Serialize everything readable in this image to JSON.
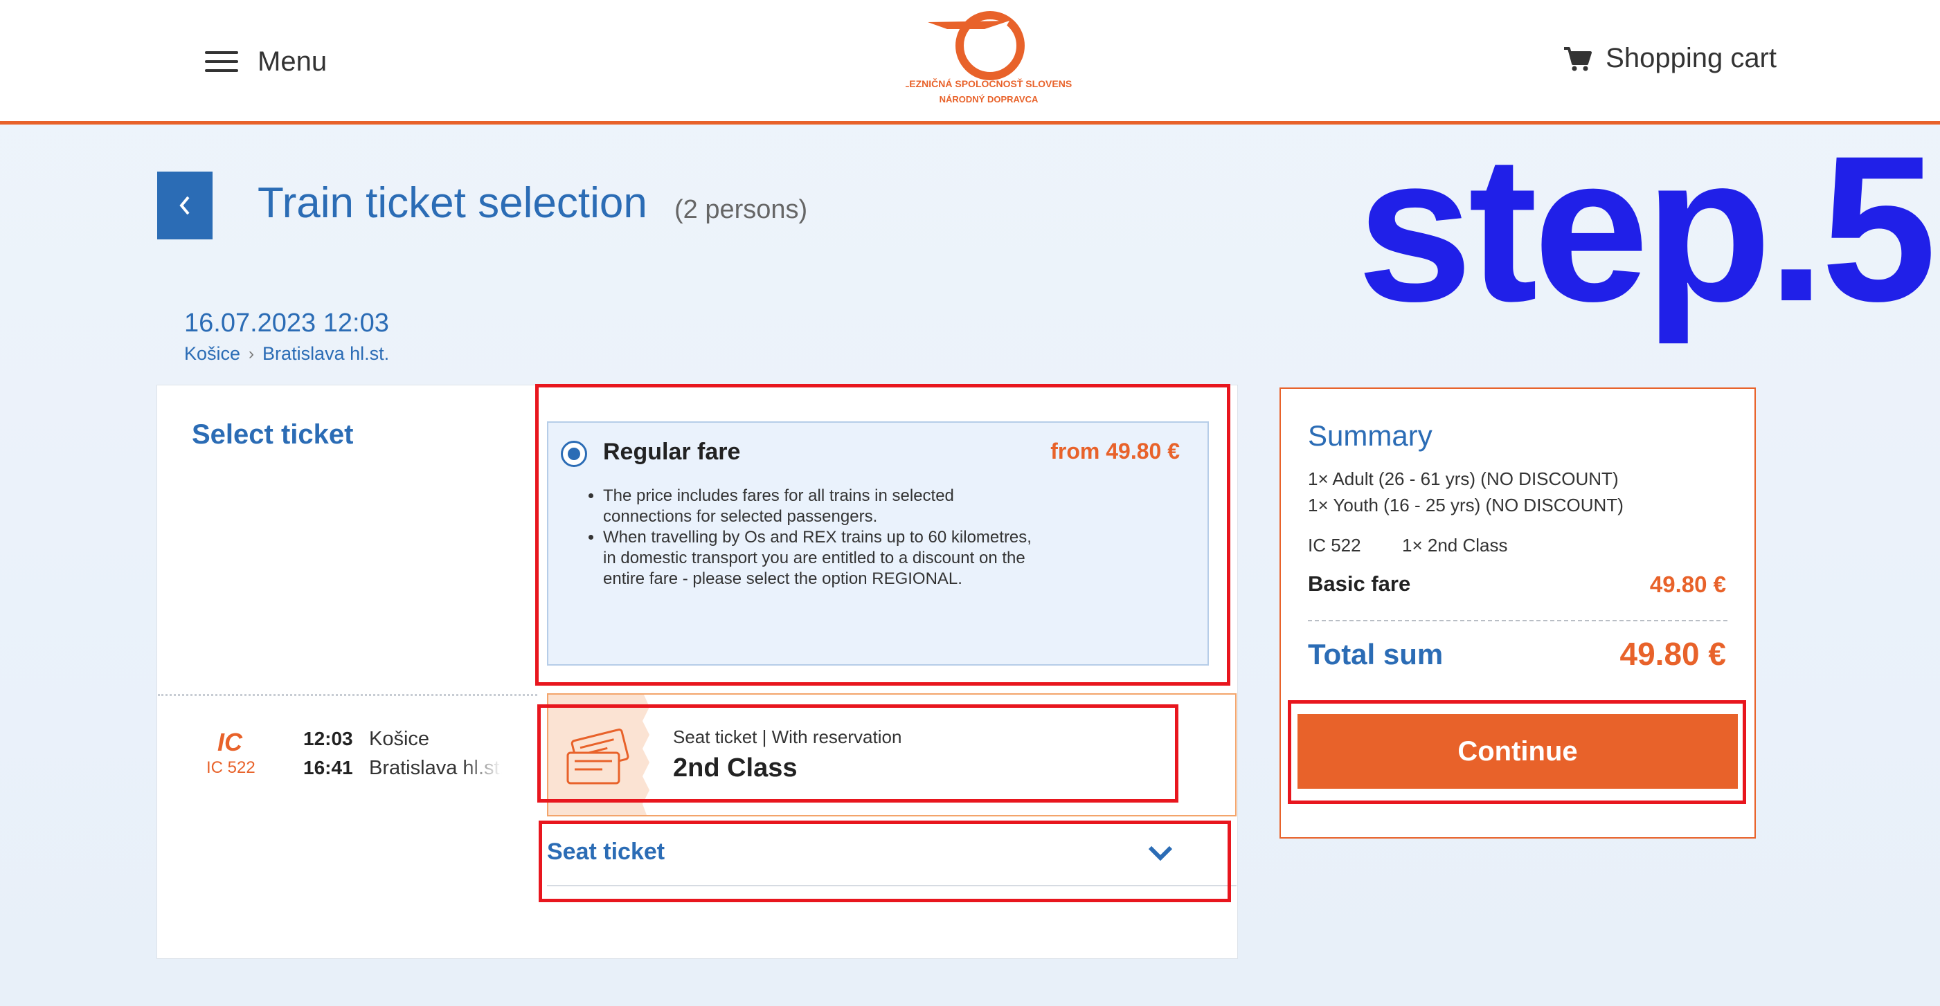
{
  "header": {
    "menu_label": "Menu",
    "cart_label": "Shopping cart",
    "logo_line1": "ŽELEZNIČNÁ SPOLOČNOSŤ SLOVENSKO",
    "logo_line2": "NÁRODNÝ DOPRAVCA",
    "accent_color": "#e8622a"
  },
  "page": {
    "title": "Train ticket selection",
    "persons": "(2 persons)",
    "step_label": "step.5"
  },
  "journey": {
    "datetime": "16.07.2023 12:03",
    "from": "Košice",
    "to": "Bratislava hl.st."
  },
  "select": {
    "title": "Select ticket",
    "fare": {
      "name": "Regular fare",
      "price": "from 49.80 €",
      "selected": true,
      "bullets": [
        "The price includes fares for all trains in selected connections for selected passengers.",
        "When travelling by Os and REX trains up to 60 kilometres, in domestic transport you are entitled to a discount on the entire fare - please select the option REGIONAL."
      ]
    }
  },
  "train": {
    "type_logo": "IC",
    "number": "IC 522",
    "departure_time": "12:03",
    "departure_station": "Košice",
    "arrival_time": "16:41",
    "arrival_station": "Bratislava hl.st."
  },
  "ticket": {
    "subtitle": "Seat ticket | With reservation",
    "class": "2nd Class",
    "icon": "ticket-icon"
  },
  "seat_section": {
    "label": "Seat ticket",
    "icon": "chevron-down-icon"
  },
  "summary": {
    "title": "Summary",
    "passengers": [
      "1× Adult (26 - 61 yrs) (NO DISCOUNT)",
      "1× Youth (16 - 25 yrs) (NO DISCOUNT)"
    ],
    "train_code": "IC 522",
    "class_count": "1× 2nd Class",
    "basic_fare_label": "Basic fare",
    "basic_fare_value": "49.80 €",
    "total_label": "Total sum",
    "total_value": "49.80 €",
    "continue_label": "Continue"
  }
}
